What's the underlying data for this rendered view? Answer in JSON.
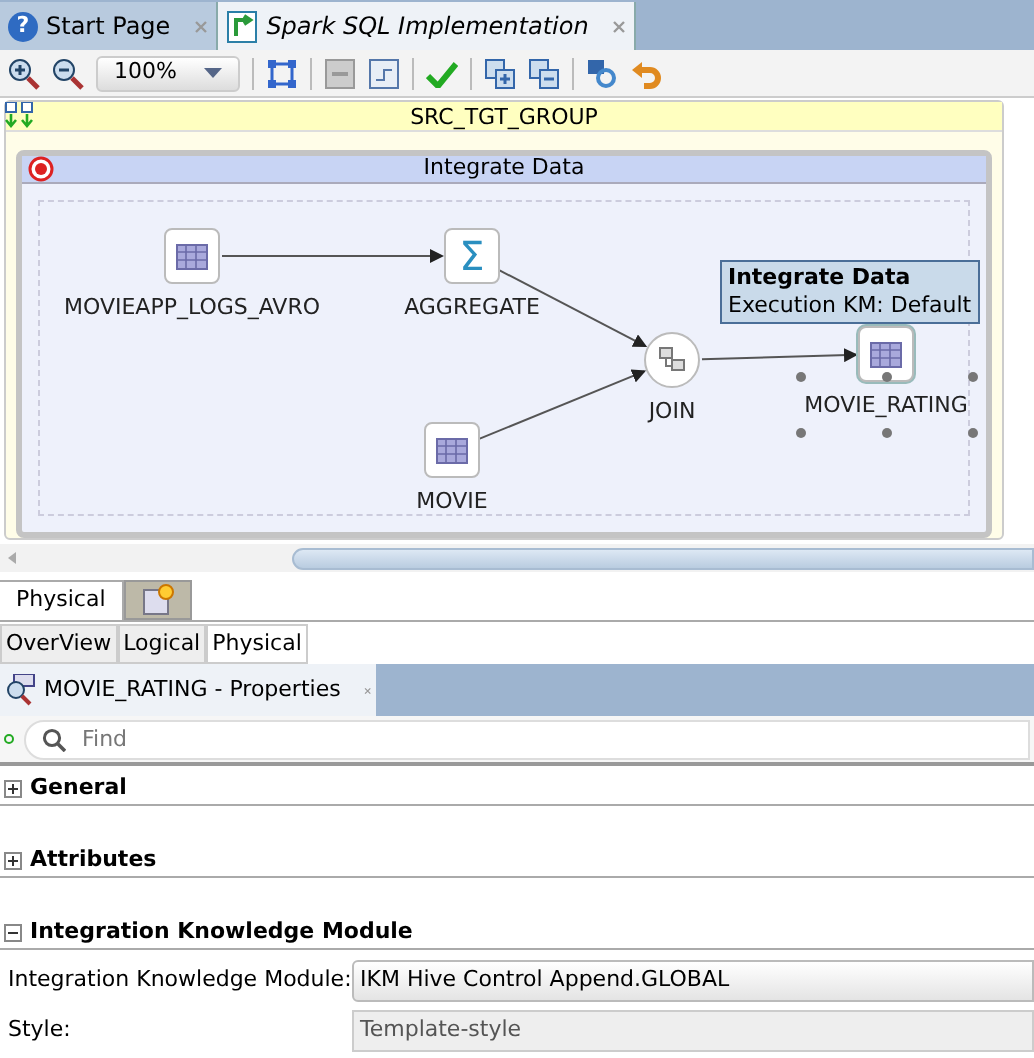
{
  "editor_tabs": [
    {
      "label": "Start Page",
      "selected": false,
      "icon_text": "?"
    },
    {
      "label": "Spark SQL Implementation",
      "selected": true
    }
  ],
  "toolbar": {
    "zoom": "100%"
  },
  "diagram": {
    "group_title": "SRC_TGT_GROUP",
    "box_title": "Integrate Data",
    "nodes": [
      {
        "label": "MOVIEAPP_LOGS_AVRO",
        "kind": "table",
        "selected": false
      },
      {
        "label": "AGGREGATE",
        "kind": "aggregate",
        "symbol": "Σ",
        "selected": false
      },
      {
        "label": "JOIN",
        "kind": "join",
        "selected": false
      },
      {
        "label": "MOVIE",
        "kind": "table",
        "selected": false
      },
      {
        "label": "MOVIE_RATING",
        "kind": "table",
        "selected": true
      }
    ],
    "tooltip": {
      "title": "Integrate Data",
      "text": "Execution KM: Default"
    }
  },
  "view_tabs": [
    {
      "label": "Physical",
      "selected": true
    }
  ],
  "sub_tabs": [
    {
      "label": "OverView",
      "selected": false
    },
    {
      "label": "Logical",
      "selected": false
    },
    {
      "label": "Physical",
      "selected": true
    }
  ],
  "properties": {
    "title": "MOVIE_RATING - Properties",
    "find_placeholder": "Find",
    "sections": [
      {
        "title": "General",
        "expanded": false
      },
      {
        "title": "Attributes",
        "expanded": false
      },
      {
        "title": "Integration Knowledge Module",
        "expanded": true,
        "fields": [
          {
            "label": "Integration Knowledge Module:",
            "value": "IKM Hive Control Append.GLOBAL",
            "kind": "dropdown"
          },
          {
            "label": "Style:",
            "value": "Template-style",
            "kind": "readonly"
          }
        ]
      }
    ]
  }
}
